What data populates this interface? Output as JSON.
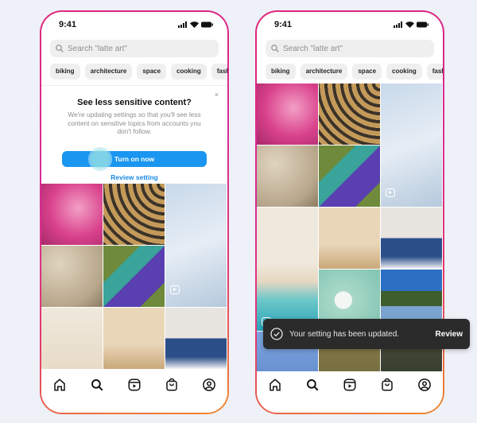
{
  "status_bar": {
    "time": "9:41"
  },
  "search": {
    "placeholder": "Search \"latte art\""
  },
  "chips": [
    "biking",
    "architecture",
    "space",
    "cooking",
    "fash"
  ],
  "prompt": {
    "title": "See less sensitive content?",
    "body": "We're updating settings so that you'll see less content on sensitive topics from accounts you don't follow.",
    "primary_label": "Turn on now",
    "secondary_label": "Review setting",
    "close_symbol": "×"
  },
  "toast": {
    "message": "Your setting has been updated.",
    "action_label": "Review"
  },
  "nav": [
    "home-icon",
    "search-icon",
    "reels-icon",
    "shop-icon",
    "profile-icon"
  ],
  "colors": {
    "primary_button": "#1a96f0",
    "link": "#1a8ae6",
    "toast_bg": "#2b2b2b"
  },
  "tiles": [
    {
      "subject": "pink picnic"
    },
    {
      "subject": "sun shadows"
    },
    {
      "subject": "water bottles",
      "reel": true
    },
    {
      "subject": "colorful climbing holds"
    },
    {
      "subject": "couple on grass"
    },
    {
      "subject": "beach palms"
    },
    {
      "subject": "dancer in denim jacket"
    },
    {
      "subject": "woman eating"
    },
    {
      "subject": "skincare products"
    },
    {
      "subject": "man with ball"
    }
  ]
}
